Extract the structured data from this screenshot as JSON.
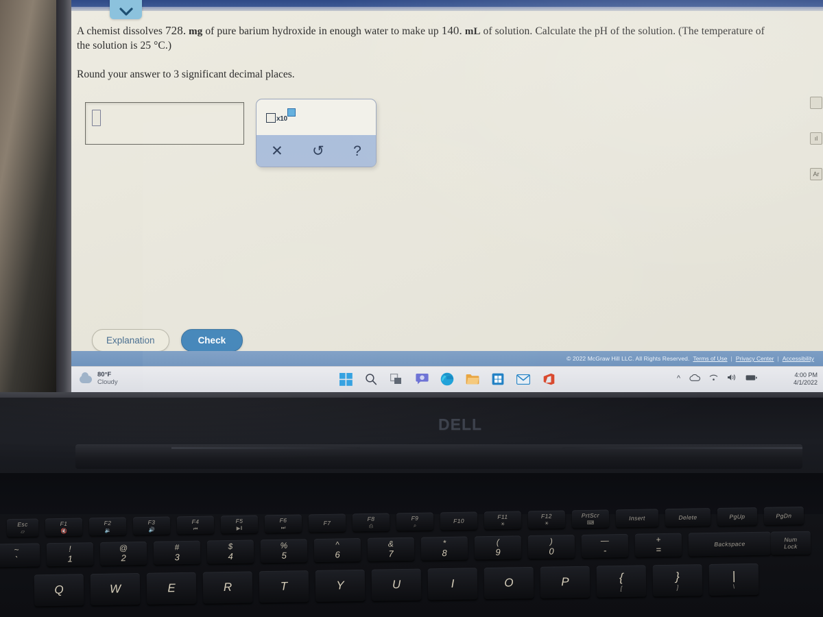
{
  "question": {
    "line1_part1": "A chemist dissolves ",
    "line1_num1": "728.",
    "line1_unit1": "mg",
    "line1_part2": " of pure barium hydroxide in enough water to make up ",
    "line1_num2": "140.",
    "line1_unit2": "mL",
    "line1_part3": " of solution. Calculate the pH of the solution. (The temperature of",
    "line2": "the solution is 25 °C.)",
    "round_instruction": "Round your answer to 3 significant decimal places."
  },
  "answer": {
    "value": "",
    "placeholder": ""
  },
  "palette": {
    "sci_notation_label": "x10",
    "clear_label": "✕",
    "undo_label": "↺",
    "help_label": "?"
  },
  "actions": {
    "explanation_label": "Explanation",
    "check_label": "Check"
  },
  "footer": {
    "copyright": "© 2022 McGraw Hill LLC. All Rights Reserved.",
    "terms": "Terms of Use",
    "privacy": "Privacy Center",
    "accessibility": "Accessibility",
    "separator": "|"
  },
  "taskbar": {
    "weather_temp": "80°F",
    "weather_cond": "Cloudy",
    "clock_time": "4:00 PM",
    "clock_date": "4/1/2022",
    "icons": [
      {
        "name": "start-icon",
        "glyph": "⊞"
      },
      {
        "name": "search-icon",
        "glyph": "⌕"
      },
      {
        "name": "task-view-icon",
        "glyph": "◱"
      },
      {
        "name": "chat-icon",
        "glyph": "◯"
      },
      {
        "name": "edge-browser-icon",
        "glyph": "◔"
      },
      {
        "name": "file-explorer-icon",
        "glyph": "▭"
      },
      {
        "name": "microsoft-store-icon",
        "glyph": "▣"
      },
      {
        "name": "mail-icon",
        "glyph": "✉"
      },
      {
        "name": "office-icon",
        "glyph": "◗"
      }
    ],
    "tray": [
      {
        "name": "show-hidden-icons",
        "glyph": "∧"
      },
      {
        "name": "onedrive-icon",
        "glyph": "☁"
      },
      {
        "name": "wifi-icon",
        "glyph": "◐"
      },
      {
        "name": "volume-icon",
        "glyph": "ᵒ)"
      },
      {
        "name": "battery-icon",
        "glyph": "▬"
      }
    ]
  },
  "laptop": {
    "brand": "DELL"
  },
  "keyboard": {
    "function_row": [
      {
        "label": "Esc",
        "icon": "▱"
      },
      {
        "label": "F1",
        "icon": "🔇"
      },
      {
        "label": "F2",
        "icon": "🔉"
      },
      {
        "label": "F3",
        "icon": "🔊"
      },
      {
        "label": "F4",
        "icon": "⏮"
      },
      {
        "label": "F5",
        "icon": "▶‖"
      },
      {
        "label": "F6",
        "icon": "⏭"
      },
      {
        "label": "F7",
        "icon": ""
      },
      {
        "label": "F8",
        "icon": "⎙"
      },
      {
        "label": "F9",
        "icon": "⌕"
      },
      {
        "label": "F10",
        "icon": ""
      },
      {
        "label": "F11",
        "icon": "☀"
      },
      {
        "label": "F12",
        "icon": "☀"
      },
      {
        "label": "PrtScr",
        "icon": "⌨"
      },
      {
        "label": "Insert",
        "icon": ""
      },
      {
        "label": "Delete",
        "icon": ""
      },
      {
        "label": "PgUp",
        "icon": ""
      },
      {
        "label": "PgDn",
        "icon": ""
      }
    ],
    "number_row": [
      {
        "top": "~",
        "bottom": "`"
      },
      {
        "top": "!",
        "bottom": "1"
      },
      {
        "top": "@",
        "bottom": "2"
      },
      {
        "top": "#",
        "bottom": "3"
      },
      {
        "top": "$",
        "bottom": "4"
      },
      {
        "top": "%",
        "bottom": "5"
      },
      {
        "top": "^",
        "bottom": "6"
      },
      {
        "top": "&",
        "bottom": "7"
      },
      {
        "top": "*",
        "bottom": "8"
      },
      {
        "top": "(",
        "bottom": "9"
      },
      {
        "top": ")",
        "bottom": "0"
      },
      {
        "top": "—",
        "bottom": "-"
      },
      {
        "top": "+",
        "bottom": "="
      }
    ],
    "backspace_label": "Backspace",
    "numlock_label_1": "Num",
    "numlock_label_2": "Lock",
    "qwerty_row": [
      "Q",
      "W",
      "E",
      "R",
      "T",
      "Y",
      "U",
      "I",
      "O",
      "P",
      "{",
      "}",
      "|"
    ],
    "qwerty_row_sub": [
      "",
      "",
      "",
      "",
      "",
      "",
      "",
      "",
      "",
      "",
      "[",
      "]",
      "\\"
    ]
  }
}
